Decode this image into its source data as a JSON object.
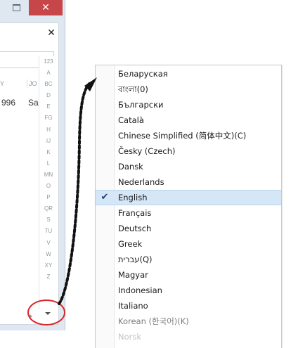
{
  "window": {
    "close_glyph": "✕",
    "panel_close_glyph": "✕"
  },
  "table": {
    "columns": [
      "Y",
      "JO"
    ],
    "row": {
      "year": "996",
      "name": "Sa"
    }
  },
  "alphabet_index": [
    "123",
    "A",
    "BC",
    "D",
    "E",
    "FG",
    "H",
    "IJ",
    "K",
    "L",
    "MN",
    "O",
    "P",
    "QR",
    "S",
    "TU",
    "V",
    "W",
    "XY",
    "Z"
  ],
  "language_menu": {
    "items": [
      {
        "label": "Беларуская"
      },
      {
        "label": "বাংলা(0)"
      },
      {
        "label": "Български"
      },
      {
        "label": "Català"
      },
      {
        "label": "Chinese Simplified (简体中文)(C)"
      },
      {
        "label": "Česky (Czech)"
      },
      {
        "label": "Dansk"
      },
      {
        "label": "Nederlands"
      },
      {
        "label": "English",
        "checked": true
      },
      {
        "label": "Français"
      },
      {
        "label": "Deutsch"
      },
      {
        "label": "Greek"
      },
      {
        "label": "עברית(Q)"
      },
      {
        "label": "Magyar"
      },
      {
        "label": "Indonesian"
      },
      {
        "label": "Italiano"
      },
      {
        "label": "Korean (한국어)(K)",
        "dim": true
      },
      {
        "label": "Norsk",
        "faded": true
      }
    ],
    "check_glyph": "✔"
  },
  "colors": {
    "highlight": "#d5e6f7",
    "close_button": "#c7464a",
    "annotation_ellipse": "#d9262b",
    "arrow": "#111111"
  }
}
